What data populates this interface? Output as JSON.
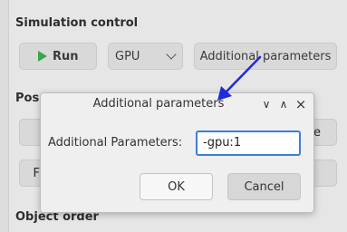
{
  "background": {
    "sections": {
      "simulation_control": "Simulation control",
      "position_prefix": "Pos",
      "object_order": "Object order"
    },
    "toolbar": {
      "run_label": "Run",
      "device_value": "GPU",
      "additional_parameters_label": "Additional parameters"
    },
    "fragments": {
      "right_e": "e",
      "left_f": "F"
    }
  },
  "dialog": {
    "title": "Additional parameters",
    "field_label": "Additional Parameters:",
    "field_value": "-gpu:1",
    "ok_label": "OK",
    "cancel_label": "Cancel",
    "controls": {
      "minimize": "∨",
      "maximize": "∧",
      "close": "×"
    }
  },
  "colors": {
    "accent": "#3c7fd6",
    "play": "#36a84a",
    "annotation_arrow": "#1f2bd8"
  },
  "icons": [
    "play-icon",
    "chevron-down-icon",
    "minimize-icon",
    "maximize-icon",
    "close-icon",
    "annotation-arrow"
  ]
}
